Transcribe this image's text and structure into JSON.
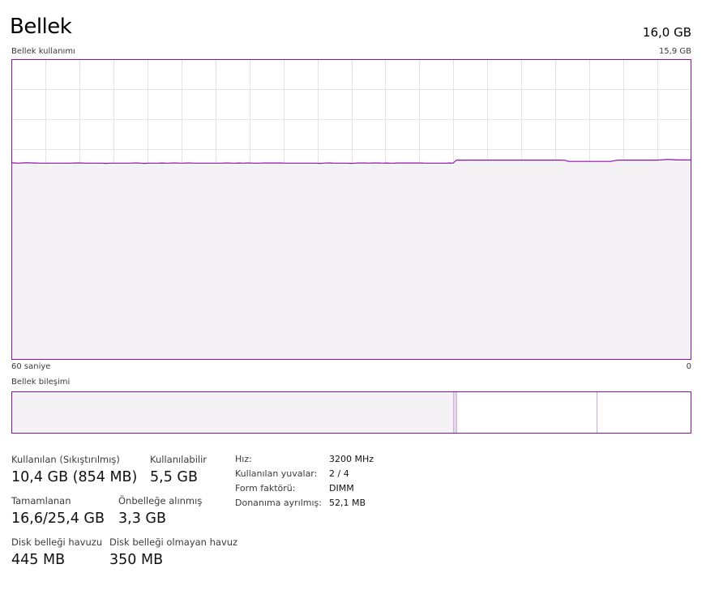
{
  "header": {
    "title": "Bellek",
    "total": "16,0 GB"
  },
  "usage_graph": {
    "label": "Bellek kullanımı",
    "max_label": "15,9 GB",
    "x_left_label": "60 saniye",
    "x_right_label": "0",
    "ylim": [
      0,
      15.9
    ],
    "series_color": "#8b12ae",
    "fill_color": "#f4f2f5",
    "values": [
      10.42,
      10.41,
      10.4,
      10.41,
      10.42,
      10.42,
      10.41,
      10.41,
      10.4,
      10.4,
      10.4,
      10.4,
      10.4,
      10.4,
      10.4,
      10.4,
      10.4,
      10.4,
      10.41,
      10.41,
      10.41,
      10.4,
      10.4,
      10.4,
      10.4,
      10.4,
      10.4,
      10.39,
      10.4,
      10.4,
      10.4,
      10.4,
      10.4,
      10.4,
      10.4,
      10.41,
      10.41,
      10.4,
      10.39,
      10.4,
      10.4,
      10.4,
      10.4,
      10.41,
      10.4,
      10.4,
      10.41,
      10.41,
      10.4,
      10.4,
      10.41,
      10.41,
      10.4,
      10.4,
      10.4,
      10.4,
      10.4,
      10.4,
      10.4,
      10.4,
      10.4,
      10.41,
      10.41,
      10.4,
      10.4,
      10.41,
      10.4,
      10.41,
      10.41,
      10.4,
      10.4,
      10.4,
      10.41,
      10.41,
      10.41,
      10.41,
      10.41,
      10.41,
      10.4,
      10.4,
      10.4,
      10.4,
      10.4,
      10.4,
      10.4,
      10.4,
      10.4,
      10.4,
      10.39,
      10.4,
      10.41,
      10.41,
      10.4,
      10.4,
      10.4,
      10.4,
      10.4,
      10.39,
      10.4,
      10.41,
      10.41,
      10.41,
      10.4,
      10.41,
      10.41,
      10.41,
      10.4,
      10.41,
      10.4,
      10.4,
      10.41,
      10.41,
      10.41,
      10.41,
      10.41,
      10.41,
      10.41,
      10.41,
      10.4,
      10.4,
      10.4,
      10.4,
      10.4,
      10.4,
      10.4,
      10.41,
      10.4,
      10.56,
      10.56,
      10.56,
      10.56,
      10.56,
      10.56,
      10.56,
      10.56,
      10.56,
      10.56,
      10.56,
      10.56,
      10.56,
      10.56,
      10.56,
      10.56,
      10.56,
      10.56,
      10.56,
      10.56,
      10.56,
      10.56,
      10.56,
      10.56,
      10.56,
      10.56,
      10.56,
      10.56,
      10.56,
      10.56,
      10.56,
      10.55,
      10.49,
      10.49,
      10.49,
      10.49,
      10.49,
      10.49,
      10.49,
      10.49,
      10.49,
      10.49,
      10.49,
      10.49,
      10.49,
      10.53,
      10.56,
      10.56,
      10.56,
      10.56,
      10.56,
      10.56,
      10.56,
      10.56,
      10.56,
      10.56,
      10.56,
      10.56,
      10.57,
      10.58,
      10.6,
      10.59,
      10.58,
      10.57,
      10.57,
      10.57,
      10.57,
      10.57
    ]
  },
  "composition": {
    "label": "Bellek bileşimi",
    "segments_gb": {
      "in_use": 10.4,
      "modified": 0.1,
      "standby": 3.3,
      "free": 2.2
    }
  },
  "stats": {
    "in_use": {
      "label": "Kullanılan (Sıkıştırılmış)",
      "value": "10,4 GB (854 MB)"
    },
    "available": {
      "label": "Kullanılabilir",
      "value": "5,5 GB"
    },
    "committed": {
      "label": "Tamamlanan",
      "value": "16,6/25,4 GB"
    },
    "cached": {
      "label": "Önbelleğe alınmış",
      "value": "3,3 GB"
    },
    "paged_pool": {
      "label": "Disk belleği havuzu",
      "value": "445 MB"
    },
    "nonpaged_pool": {
      "label": "Disk belleği olmayan havuz",
      "value": "350 MB"
    }
  },
  "specs": {
    "speed": {
      "label": "Hız:",
      "value": "3200 MHz"
    },
    "slots": {
      "label": "Kullanılan yuvalar:",
      "value": "2 / 4"
    },
    "form_factor": {
      "label": "Form faktörü:",
      "value": "DIMM"
    },
    "hardware_reserved": {
      "label": "Donanıma ayrılmış:",
      "value": "52,1 MB"
    }
  }
}
